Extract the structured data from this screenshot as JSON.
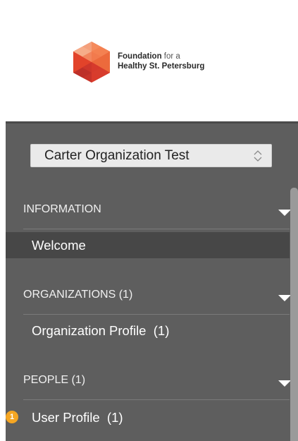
{
  "brand": {
    "name_bold": "Foundation",
    "name_light": " for a",
    "name_line2": "Healthy St. Petersburg"
  },
  "org_selector": {
    "selected": "Carter Organization Test"
  },
  "sections": [
    {
      "title": "INFORMATION",
      "items": [
        {
          "label": "Welcome",
          "active": true
        }
      ]
    },
    {
      "title": "ORGANIZATIONS (1)",
      "items": [
        {
          "label": "Organization Profile  (1)",
          "active": false
        }
      ]
    },
    {
      "title": "PEOPLE (1)",
      "items": [
        {
          "label": "User Profile  (1)",
          "active": false,
          "badge": "1"
        }
      ]
    }
  ],
  "colors": {
    "sidebar_bg": "#5e5e5e",
    "active_item_bg": "#474747",
    "badge": "#f5a623",
    "logo_orange": "#e8502d"
  }
}
